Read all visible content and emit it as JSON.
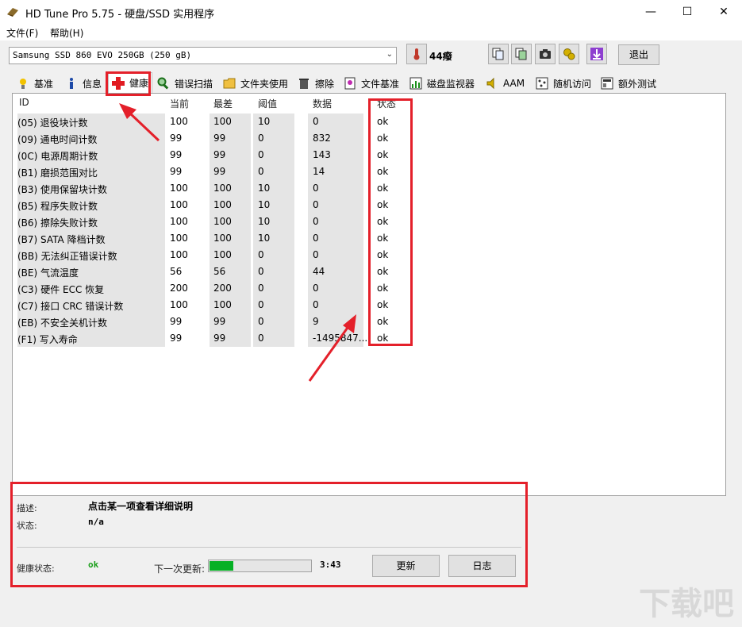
{
  "window": {
    "title": "HD Tune Pro 5.75 - 硬盘/SSD 实用程序",
    "minimize": "—",
    "maximize": "☐",
    "close": "✕"
  },
  "menu": [
    {
      "label": "文件(F)"
    },
    {
      "label": "帮助(H)"
    }
  ],
  "toolbar": {
    "drive": "Samsung SSD 860 EVO 250GB (250 gB)",
    "temperature": "44癈",
    "exit_label": "退出"
  },
  "tabs": [
    {
      "label": "基准",
      "icon": "benchmark-icon"
    },
    {
      "label": "信息",
      "icon": "info-icon"
    },
    {
      "label": "健康",
      "icon": "health-cross-icon",
      "active": true
    },
    {
      "label": "错误扫描",
      "icon": "magnifier-icon"
    },
    {
      "label": "文件夹使用",
      "icon": "folder-icon"
    },
    {
      "label": "擦除",
      "icon": "trash-icon"
    },
    {
      "label": "文件基准",
      "icon": "file-benchmark-icon"
    },
    {
      "label": "磁盘监视器",
      "icon": "monitor-chart-icon"
    },
    {
      "label": "AAM",
      "icon": "speaker-icon"
    },
    {
      "label": "随机访问",
      "icon": "random-access-icon"
    },
    {
      "label": "额外测试",
      "icon": "extra-tests-icon"
    }
  ],
  "smart": {
    "columns": [
      "ID",
      "当前",
      "最差",
      "阈值",
      "数据",
      "状态"
    ],
    "rows": [
      [
        "(05) 退役块计数",
        "100",
        "100",
        "10",
        "0",
        "ok"
      ],
      [
        "(09) 通电时间计数",
        "99",
        "99",
        "0",
        "832",
        "ok"
      ],
      [
        "(0C) 电源周期计数",
        "99",
        "99",
        "0",
        "143",
        "ok"
      ],
      [
        "(B1) 磨损范围对比",
        "99",
        "99",
        "0",
        "14",
        "ok"
      ],
      [
        "(B3) 使用保留块计数",
        "100",
        "100",
        "10",
        "0",
        "ok"
      ],
      [
        "(B5) 程序失败计数",
        "100",
        "100",
        "10",
        "0",
        "ok"
      ],
      [
        "(B6) 擦除失败计数",
        "100",
        "100",
        "10",
        "0",
        "ok"
      ],
      [
        "(B7) SATA 降档计数",
        "100",
        "100",
        "10",
        "0",
        "ok"
      ],
      [
        "(BB) 无法纠正错误计数",
        "100",
        "100",
        "0",
        "0",
        "ok"
      ],
      [
        "(BE) 气流温度",
        "56",
        "56",
        "0",
        "44",
        "ok"
      ],
      [
        "(C3) 硬件 ECC 恢复",
        "200",
        "200",
        "0",
        "0",
        "ok"
      ],
      [
        "(C7) 接口 CRC 错误计数",
        "100",
        "100",
        "0",
        "0",
        "ok"
      ],
      [
        "(EB) 不安全关机计数",
        "99",
        "99",
        "0",
        "9",
        "ok"
      ],
      [
        "(F1) 写入寿命",
        "99",
        "99",
        "0",
        "-1495847...",
        "ok"
      ]
    ]
  },
  "details": {
    "desc_label": "描述:",
    "desc_value": "点击某一项查看详细说明",
    "status_label": "状态:",
    "status_value": "n/a",
    "health_label": "健康状态:",
    "health_value": "ok",
    "next_update_label": "下一次更新:",
    "countdown": "3:43",
    "progress_fraction": 0.23,
    "update_button": "更新",
    "log_button": "日志"
  },
  "colors": {
    "accent_red": "#e4202a",
    "progress_green": "#06b025",
    "health_ok": "#1a9e1a"
  },
  "watermark": "下载吧"
}
